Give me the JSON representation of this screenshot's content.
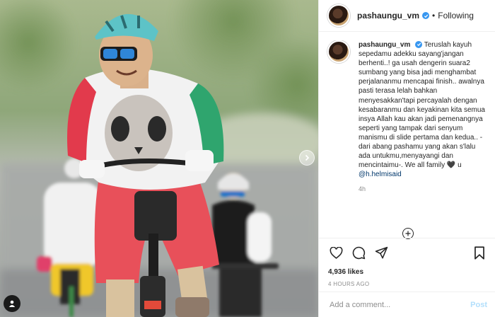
{
  "header": {
    "username": "pashaungu_vm",
    "separator": "•",
    "follow_label": "Following"
  },
  "caption": {
    "username": "pashaungu_vm",
    "text": "Teruslah kayuh sepedamu adekku sayang'jangan berhenti..! ga usah dengerin suara2 sumbang yang bisa jadi menghambat perjalananmu mencapai finish.. awalnya pasti terasa lelah bahkan menyesakkan'tapi percayalah dengan kesabaranmu dan keyakinan kita semua insya Allah kau akan jadi pemenangnya seperti yang tampak dari senyum manismu di slide pertama dan kedua.. -dari abang pashamu yang akan s'lalu ada untukmu,menyayangi dan mencintaimu-. We all family 🖤 u",
    "mention": "@h.helmisaid",
    "age": "4h"
  },
  "actions": {
    "like_icon": "heart-icon",
    "comment_icon": "comment-icon",
    "share_icon": "share-icon",
    "save_icon": "bookmark-icon"
  },
  "likes": "4,936 likes",
  "timestamp": "4 HOURS AGO",
  "comment_box": {
    "placeholder": "Add a comment...",
    "post_label": "Post"
  },
  "colors": {
    "verified": "#3897f0",
    "link": "#00376b",
    "post_disabled": "#b2dffc",
    "muted": "#8e8e8e"
  }
}
